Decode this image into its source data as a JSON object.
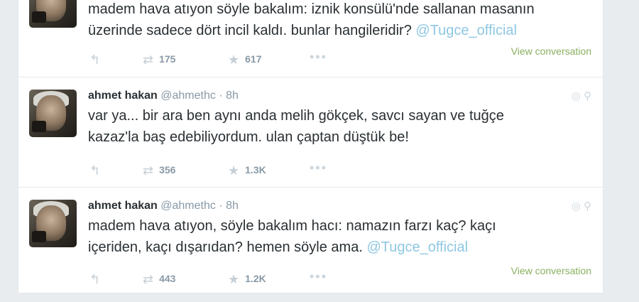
{
  "tweets": [
    {
      "line1": "madem hava atıyon söyle bakalım: iznik konsülü'nde sallanan masanın",
      "line2": "üzerinde sadece dört incil kaldı. bunlar hangileridir? ",
      "mention": "@Tugce_official",
      "view_conversation": "View conversation",
      "retweets": "175",
      "favorites": "617"
    },
    {
      "fullname": "ahmet hakan",
      "username": "@ahmethc",
      "sep": "·",
      "time": "8h",
      "line1": "var ya... bir ara ben aynı anda melih gökçek, savcı sayan ve tuğçe",
      "line2": "kazaz'la baş edebiliyordum. ulan çaptan düştük be!",
      "retweets": "356",
      "favorites": "1.3K"
    },
    {
      "fullname": "ahmet hakan",
      "username": "@ahmethc",
      "sep": "·",
      "time": "8h",
      "line1": "madem hava atıyon, söyle bakalım hacı: namazın farzı kaç? kaçı",
      "line2": "içeriden, kaçı dışarıdan? hemen söyle ama. ",
      "mention": "@Tugce_official",
      "view_conversation": "View conversation",
      "retweets": "443",
      "favorites": "1.2K"
    }
  ],
  "icons": {
    "reply": "↰",
    "retweet": "⇄",
    "favorite": "★",
    "more": "•••",
    "geo": "◎ ⚲"
  }
}
